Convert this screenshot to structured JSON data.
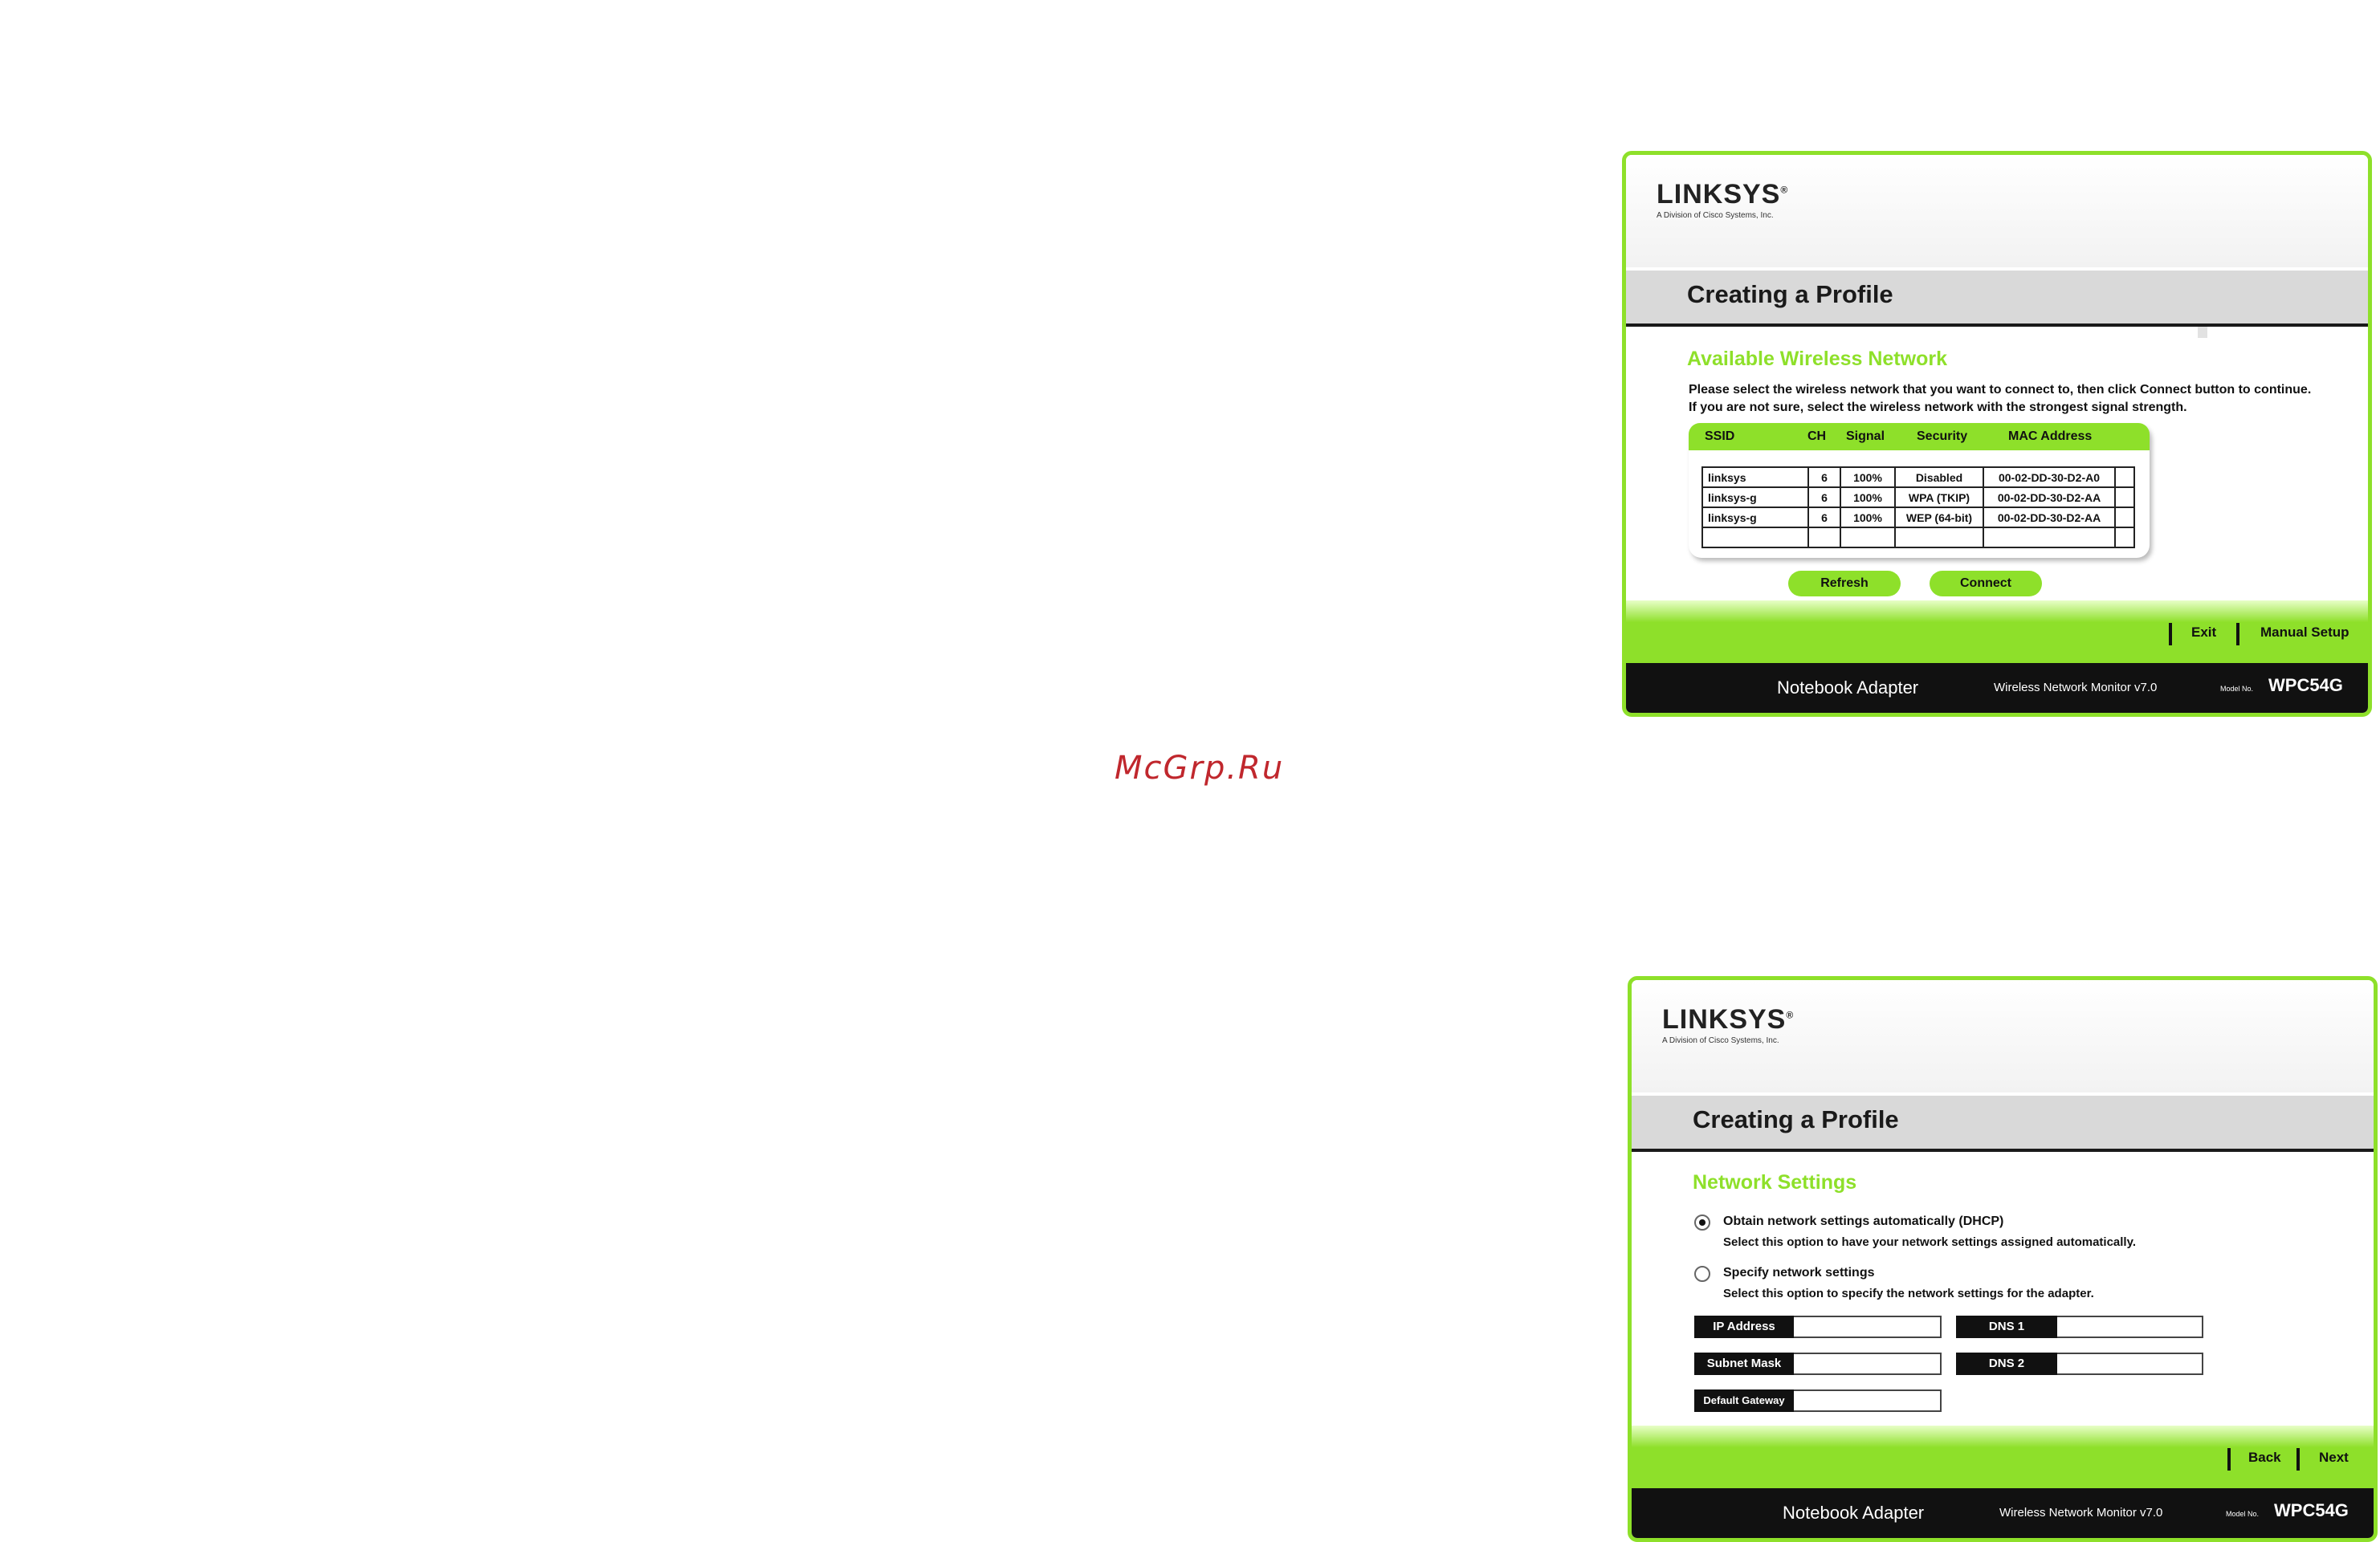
{
  "watermark": "McGrp.Ru",
  "common": {
    "logo": "LINKSYS",
    "logo_mark": "®",
    "logo_sub": "A Division of Cisco Systems, Inc.",
    "title": "Creating a Profile",
    "footer_adapter": "Notebook Adapter",
    "footer_monitor": "Wireless Network Monitor v7.0",
    "footer_modelno_label": "Model No.",
    "footer_model": "WPC54G"
  },
  "screen1": {
    "section_title": "Available Wireless Network",
    "desc_line1_prefix": "Please select the wireless network that you want to connect to, then click",
    "desc_line1_bold": "Connect",
    "desc_line1_suffix": "button to continue.",
    "desc_line2": "If you are not sure, select the wireless network with the strongest signal strength.",
    "columns": [
      "SSID",
      "CH",
      "Signal",
      "Security",
      "MAC Address"
    ],
    "rows": [
      [
        "linksys",
        "6",
        "100%",
        "Disabled",
        "00-02-DD-30-D2-A0"
      ],
      [
        "linksys-g",
        "6",
        "100%",
        "WPA (TKIP)",
        "00-02-DD-30-D2-AA"
      ],
      [
        "linksys-g",
        "6",
        "100%",
        "WEP (64-bit)",
        "00-02-DD-30-D2-AA"
      ],
      [
        "",
        "",
        "",
        "",
        ""
      ]
    ],
    "refresh_label": "Refresh",
    "connect_label": "Connect",
    "exit_label": "Exit",
    "manual_setup_label": "Manual Setup"
  },
  "screen2": {
    "section_title": "Network Settings",
    "option_dhcp_title": "Obtain network settings automatically (DHCP)",
    "option_dhcp_desc": "Select this option to have your network settings assigned automatically.",
    "option_dhcp_selected": true,
    "option_static_title": "Specify network settings",
    "option_static_desc": "Select this option to specify the network settings for the adapter.",
    "ip_label": "IP Address",
    "ip_value": "",
    "subnet_label": "Subnet Mask",
    "subnet_value": "",
    "gateway_label": "Default Gateway",
    "gateway_value": "",
    "dns1_label": "DNS 1",
    "dns1_value": "",
    "dns2_label": "DNS 2",
    "dns2_value": "",
    "back_label": "Back",
    "next_label": "Next"
  }
}
